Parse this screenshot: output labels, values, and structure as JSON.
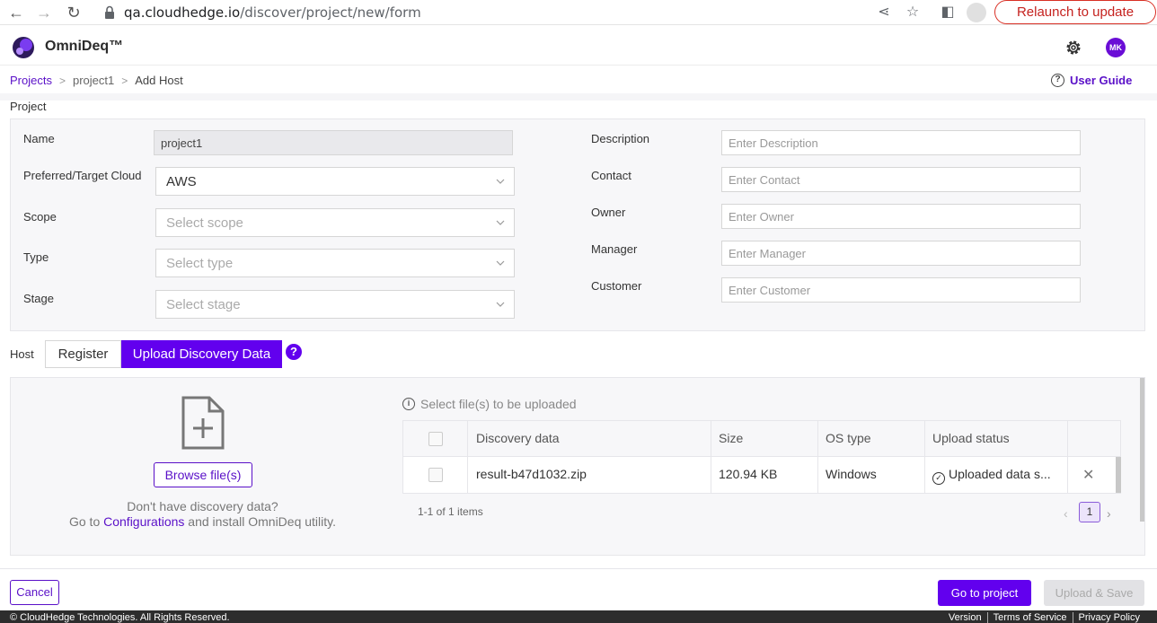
{
  "browser": {
    "url_host": "qa.cloudhedge.io",
    "url_path": "/discover/project/new/form",
    "relaunch_label": "Relaunch to update"
  },
  "header": {
    "brand": "OmniDeq™",
    "user_initials": "MK"
  },
  "breadcrumb": {
    "items": [
      "Projects",
      "project1",
      "Add Host"
    ],
    "user_guide": "User Guide"
  },
  "project": {
    "section_title": "Project",
    "left_fields": [
      {
        "label": "Name",
        "value": "project1"
      },
      {
        "label": "Preferred/Target Cloud",
        "value": "AWS"
      },
      {
        "label": "Scope",
        "placeholder": "Select scope"
      },
      {
        "label": "Type",
        "placeholder": "Select type"
      },
      {
        "label": "Stage",
        "placeholder": "Select stage"
      }
    ],
    "right_fields": [
      {
        "label": "Description",
        "placeholder": "Enter Description"
      },
      {
        "label": "Contact",
        "placeholder": "Enter Contact"
      },
      {
        "label": "Owner",
        "placeholder": "Enter Owner"
      },
      {
        "label": "Manager",
        "placeholder": "Enter Manager"
      },
      {
        "label": "Customer",
        "placeholder": "Enter Customer"
      }
    ]
  },
  "host": {
    "label": "Host",
    "tabs": [
      "Register",
      "Upload Discovery Data"
    ],
    "help_glyph": "?"
  },
  "upload": {
    "browse_label": "Browse file(s)",
    "no_data_line1": "Don't have discovery data?",
    "no_data_prefix": "Go to ",
    "config_link": "Configurations",
    "no_data_suffix": " and install OmniDeq utility.",
    "select_info": "Select file(s) to be uploaded",
    "columns": [
      "Discovery data",
      "Size",
      "OS type",
      "Upload status"
    ],
    "rows": [
      {
        "file": "result-b47d1032.zip",
        "size": "120.94 KB",
        "os": "Windows",
        "status": "Uploaded data s..."
      }
    ],
    "pager_text": "1-1 of 1 items",
    "current_page": "1"
  },
  "actions": {
    "cancel": "Cancel",
    "go_to_project": "Go to project",
    "upload_save": "Upload & Save"
  },
  "footer": {
    "copyright": "© CloudHedge Technologies. All Rights Reserved.",
    "links": [
      "Version",
      "Terms of Service",
      "Privacy Policy"
    ]
  },
  "colors": {
    "accent": "#6200ee",
    "link": "#5a10c8"
  }
}
